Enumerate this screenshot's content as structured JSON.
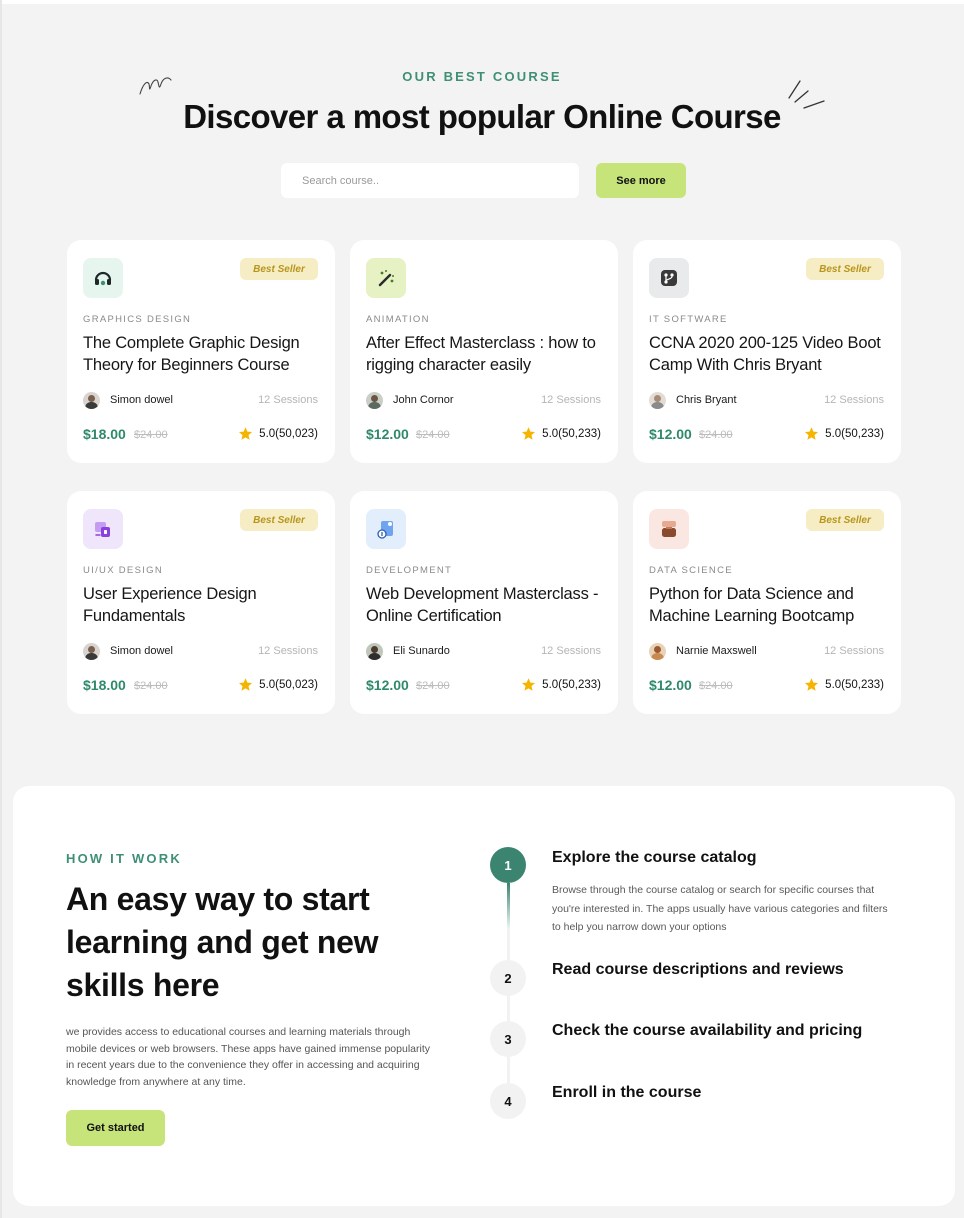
{
  "header": {
    "eyebrow": "OUR BEST COURSE",
    "title": "Discover a most popular Online Course"
  },
  "search": {
    "placeholder": "Search course..",
    "button_label": "See more"
  },
  "colors": {
    "accent_green": "#3f8f76",
    "lime": "#c6e47a",
    "badge_bg": "#f6edc5",
    "badge_text": "#b8961d",
    "price_green": "#2f8a6a"
  },
  "courses": [
    {
      "icon": "headset-icon",
      "badge": "Best Seller",
      "category": "GRAPHICS DESIGN",
      "title": "The Complete Graphic Design Theory for Beginners Course",
      "author": "Simon dowel",
      "sessions": "12 Sessions",
      "price": "$18.00",
      "old_price": "$24.00",
      "rating": "5.0(50,023)"
    },
    {
      "icon": "magic-wand-icon",
      "badge": "",
      "category": "ANIMATION",
      "title": "After Effect Masterclass : how to rigging character easily",
      "author": "John Cornor",
      "sessions": "12 Sessions",
      "price": "$12.00",
      "old_price": "$24.00",
      "rating": "5.0(50,233)"
    },
    {
      "icon": "git-branch-icon",
      "badge": "Best Seller",
      "category": "IT SOFTWARE",
      "title": "CCNA 2020 200-125 Video Boot Camp With Chris Bryant",
      "author": "Chris Bryant",
      "sessions": "12 Sessions",
      "price": "$12.00",
      "old_price": "$24.00",
      "rating": "5.0(50,233)"
    },
    {
      "icon": "design-tools-icon",
      "badge": "Best Seller",
      "category": "UI/UX DESIGN",
      "title": "User Experience Design Fundamentals",
      "author": "Simon dowel",
      "sessions": "12 Sessions",
      "price": "$18.00",
      "old_price": "$24.00",
      "rating": "5.0(50,023)"
    },
    {
      "icon": "code-document-icon",
      "badge": "",
      "category": "DEVELOPMENT",
      "title": "Web Development Masterclass - Online Certification",
      "author": "Eli Sunardo",
      "sessions": "12 Sessions",
      "price": "$12.00",
      "old_price": "$24.00",
      "rating": "5.0(50,233)"
    },
    {
      "icon": "database-icon",
      "badge": "Best Seller",
      "category": "DATA SCIENCE",
      "title": "Python for Data Science and Machine Learning Bootcamp",
      "author": "Narnie Maxswell",
      "sessions": "12 Sessions",
      "price": "$12.00",
      "old_price": "$24.00",
      "rating": "5.0(50,233)"
    }
  ],
  "how": {
    "eyebrow": "HOW IT WORK",
    "title": "An easy way to start learning and get new skills here",
    "description": "we provides access to educational courses and learning materials through mobile devices or web browsers. These apps have gained immense popularity in recent years due to the convenience they offer in accessing and acquiring knowledge from anywhere at any time.",
    "cta": "Get started",
    "steps": [
      {
        "number": "1",
        "title": "Explore the course catalog",
        "description": "Browse through the course catalog or search for specific courses that you're interested in. The apps usually have various categories and filters to help you narrow down your options"
      },
      {
        "number": "2",
        "title": "Read course descriptions and reviews"
      },
      {
        "number": "3",
        "title": "Check the course availability and pricing"
      },
      {
        "number": "4",
        "title": "Enroll in the course"
      }
    ]
  }
}
